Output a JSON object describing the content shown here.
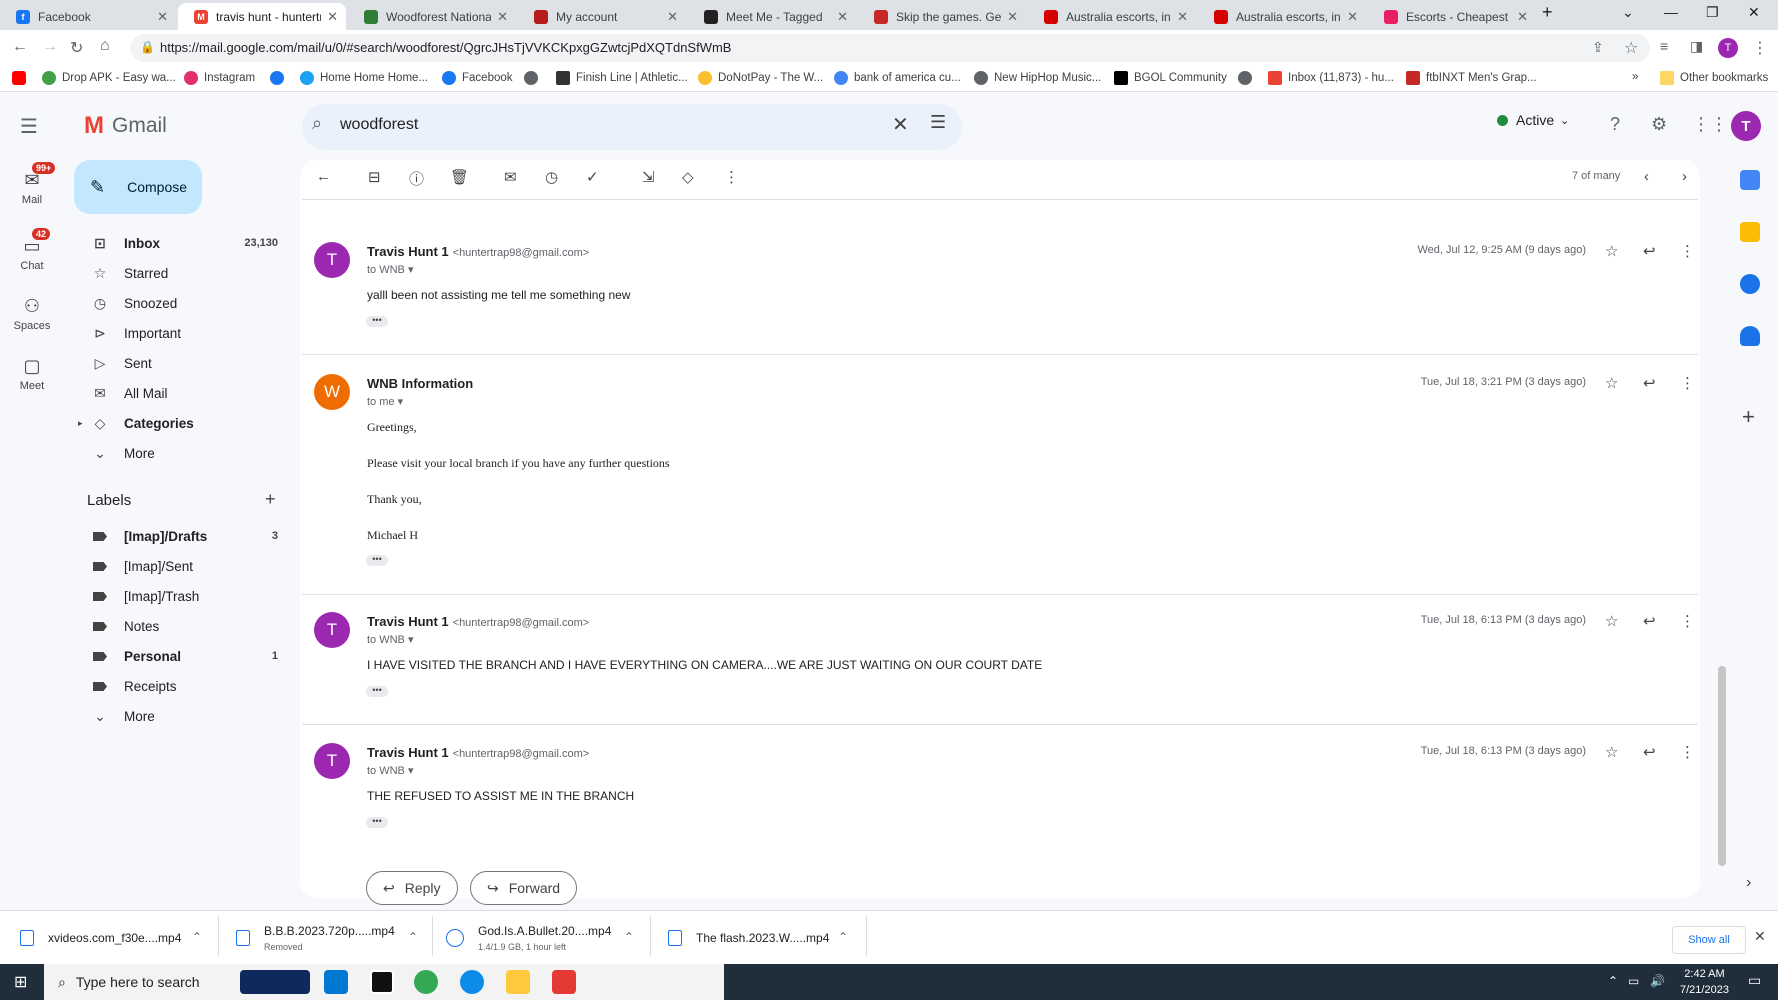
{
  "browser": {
    "tabs": [
      {
        "title": "Facebook",
        "color": "#1877f2"
      },
      {
        "title": "travis hunt - huntertra",
        "color": "#ea4335",
        "active": true
      },
      {
        "title": "Woodforest National B",
        "color": "#2e7d32"
      },
      {
        "title": "My account",
        "color": "#b71c1c"
      },
      {
        "title": "Meet Me - Tagged",
        "color": "#212121"
      },
      {
        "title": "Skip the games. Get S",
        "color": "#c62828"
      },
      {
        "title": "Australia escorts, indiv",
        "color": "#d50000"
      },
      {
        "title": "Australia escorts, indiv",
        "color": "#d50000"
      },
      {
        "title": "Escorts - Cheapest GF",
        "color": "#e91e63"
      }
    ],
    "url": "https://mail.google.com/mail/u/0/#search/woodforest/QgrcJHsTjVVKCKpxgGZwtcjPdXQTdnSfWmB",
    "bookmarks": [
      "Drop APK - Easy wa...",
      "Instagram",
      "",
      "Home Home Home...",
      "Facebook",
      "",
      "Finish Line | Athletic...",
      "DoNotPay - The W...",
      "bank of america cu...",
      "New HipHop Music...",
      "BGOL Community",
      "",
      "Inbox (11,873) - hu...",
      "ftbINXT Men's Grap..."
    ],
    "other_bookmarks": "Other bookmarks",
    "profile_initial": "T"
  },
  "gmail": {
    "logo_text": "Gmail",
    "search_value": "woodforest",
    "status": "Active",
    "avatar": "T",
    "rail": [
      {
        "label": "Mail",
        "badge": "99+"
      },
      {
        "label": "Chat",
        "badge": "42"
      },
      {
        "label": "Spaces",
        "badge": ""
      },
      {
        "label": "Meet",
        "badge": ""
      }
    ],
    "compose": "Compose",
    "folders": [
      {
        "label": "Inbox",
        "count": "23,130",
        "icon": "inbox-icon",
        "glyph": "⊡",
        "bold": true
      },
      {
        "label": "Starred",
        "count": "",
        "icon": "star-icon",
        "glyph": "☆"
      },
      {
        "label": "Snoozed",
        "count": "",
        "icon": "clock-icon",
        "glyph": "◷"
      },
      {
        "label": "Important",
        "count": "",
        "icon": "important-icon",
        "glyph": "⊳"
      },
      {
        "label": "Sent",
        "count": "",
        "icon": "send-icon",
        "glyph": "▷"
      },
      {
        "label": "All Mail",
        "count": "",
        "icon": "all-mail-icon",
        "glyph": "✉"
      },
      {
        "label": "Categories",
        "count": "",
        "icon": "label-icon",
        "glyph": "◇",
        "bold": true
      },
      {
        "label": "More",
        "count": "",
        "icon": "chevron-down-icon",
        "glyph": "⌄"
      }
    ],
    "labels_heading": "Labels",
    "labels": [
      {
        "label": "[Imap]/Drafts",
        "count": "3",
        "bold": true
      },
      {
        "label": "[Imap]/Sent",
        "count": ""
      },
      {
        "label": "[Imap]/Trash",
        "count": ""
      },
      {
        "label": "Notes",
        "count": ""
      },
      {
        "label": "Personal",
        "count": "1",
        "bold": true
      },
      {
        "label": "Receipts",
        "count": ""
      },
      {
        "label": "More",
        "count": ""
      }
    ],
    "pager": "7 of many",
    "messages": [
      {
        "initial": "T",
        "color": "#9c27b0",
        "sender": "Travis Hunt 1",
        "email": "<huntertrap98@gmail.com>",
        "to": "to WNB",
        "date": "Wed, Jul 12, 9:25 AM (9 days ago)",
        "body": [
          "yalll been not assisting me tell me something new"
        ]
      },
      {
        "initial": "W",
        "color": "#ef6c00",
        "sender": "WNB Information",
        "email": "",
        "to": "to me",
        "date": "Tue, Jul 18, 3:21 PM (3 days ago)",
        "body": [
          "Greetings,",
          "Please visit your local branch if you have any further questions",
          "Thank you,",
          "Michael H"
        ]
      },
      {
        "initial": "T",
        "color": "#9c27b0",
        "sender": "Travis Hunt 1",
        "email": "<huntertrap98@gmail.com>",
        "to": "to WNB",
        "date": "Tue, Jul 18, 6:13 PM (3 days ago)",
        "body": [
          "I HAVE VISITED THE BRANCH AND I HAVE EVERYTHING ON CAMERA....WE ARE JUST WAITING ON OUR COURT DATE"
        ]
      },
      {
        "initial": "T",
        "color": "#9c27b0",
        "sender": "Travis Hunt 1",
        "email": "<huntertrap98@gmail.com>",
        "to": "to WNB",
        "date": "Tue, Jul 18, 6:13 PM (3 days ago)",
        "body": [
          "THE REFUSED TO ASSIST ME IN THE BRANCH"
        ]
      }
    ],
    "reply": "Reply",
    "forward": "Forward"
  },
  "downloads": [
    {
      "name": "xvideos.com_f30e....mp4",
      "sub": ""
    },
    {
      "name": "B.B.B.2023.720p.....mp4",
      "sub": "Removed"
    },
    {
      "name": "God.Is.A.Bullet.20....mp4",
      "sub": "1.4/1.9 GB, 1 hour left"
    },
    {
      "name": "The flash.2023.W.....mp4",
      "sub": ""
    }
  ],
  "show_all": "Show all",
  "taskbar": {
    "search": "Type here to search",
    "time": "2:42 AM",
    "date": "7/21/2023"
  }
}
